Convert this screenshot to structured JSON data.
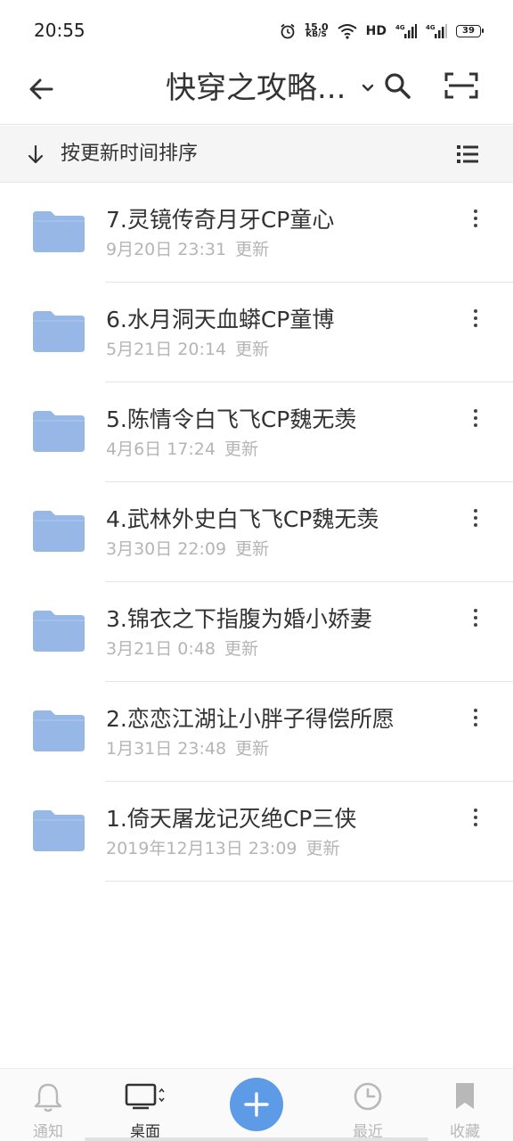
{
  "status_bar": {
    "time": "20:55",
    "net_speed_value": "15.0",
    "net_speed_unit": "KB/S",
    "hd_label": "HD",
    "sim1_label": "4G",
    "sim2_label": "4G",
    "battery": "39"
  },
  "header": {
    "title": "快穿之攻略..."
  },
  "sort_bar": {
    "label": "按更新时间排序"
  },
  "files": [
    {
      "name": "7.灵镜传奇月牙CP童心",
      "date": "9月20日 23:31",
      "status": "更新"
    },
    {
      "name": "6.水月洞天血蟒CP童博",
      "date": "5月21日 20:14",
      "status": "更新"
    },
    {
      "name": "5.陈情令白飞飞CP魏无羡",
      "date": "4月6日 17:24",
      "status": "更新"
    },
    {
      "name": "4.武林外史白飞飞CP魏无羡",
      "date": "3月30日 22:09",
      "status": "更新"
    },
    {
      "name": "3.锦衣之下指腹为婚小娇妻",
      "date": "3月21日 0:48",
      "status": "更新"
    },
    {
      "name": "2.恋恋江湖让小胖子得偿所愿",
      "date": "1月31日 23:48",
      "status": "更新"
    },
    {
      "name": "1.倚天屠龙记灭绝CP三侠",
      "date": "2019年12月13日 23:09",
      "status": "更新"
    }
  ],
  "bottom_nav": {
    "notify": "通知",
    "desktop": "桌面",
    "recent": "最近",
    "favorites": "收藏"
  },
  "colors": {
    "folder": "#97b8e6",
    "accent": "#5d9be6",
    "inactive": "#b8b8b8"
  }
}
